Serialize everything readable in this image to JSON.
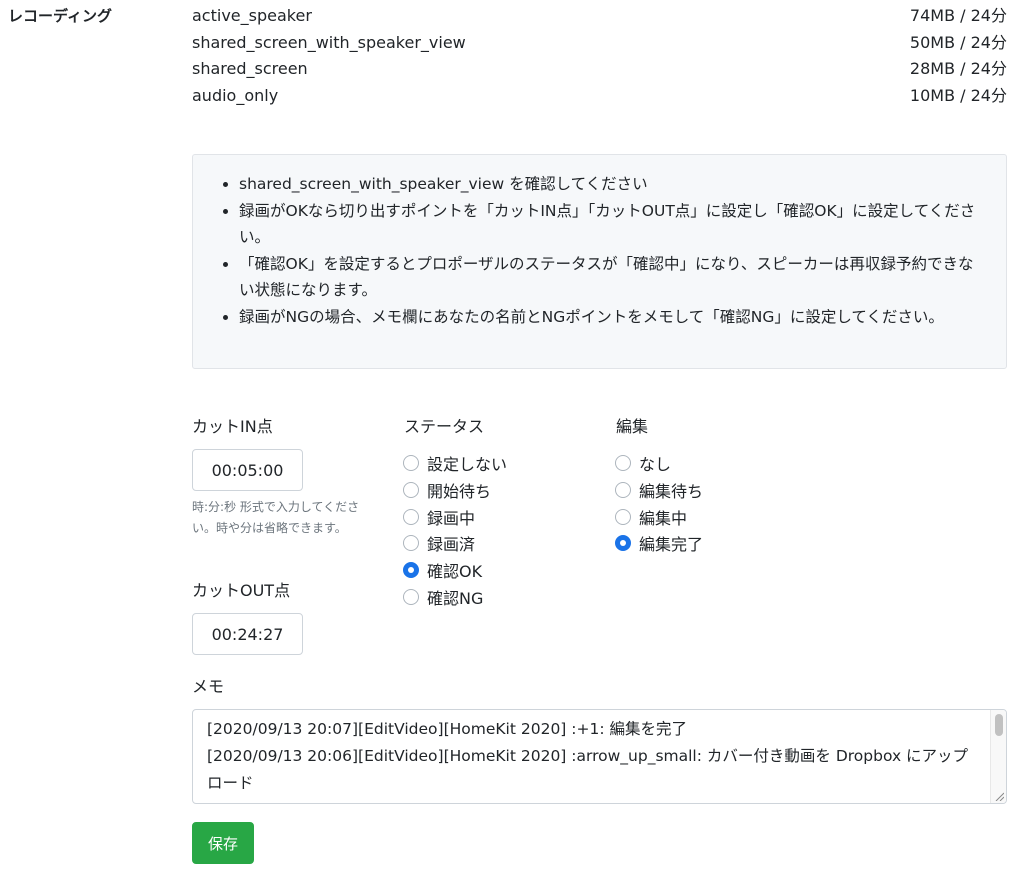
{
  "recordings": {
    "label": "レコーディング",
    "items": [
      {
        "name": "active_speaker",
        "size": "74MB / 24分"
      },
      {
        "name": "shared_screen_with_speaker_view",
        "size": "50MB / 24分"
      },
      {
        "name": "shared_screen",
        "size": "28MB / 24分"
      },
      {
        "name": "audio_only",
        "size": "10MB / 24分"
      }
    ]
  },
  "instructions": [
    "shared_screen_with_speaker_view を確認してください",
    "録画がOKなら切り出すポイントを「カットIN点」「カットOUT点」に設定し「確認OK」に設定してください。",
    "「確認OK」を設定するとプロポーザルのステータスが「確認中」になり、スピーカーは再収録予約できない状態になります。",
    "録画がNGの場合、メモ欄にあなたの名前とNGポイントをメモして「確認NG」に設定してください。"
  ],
  "cut_in": {
    "label": "カットIN点",
    "value": "00:05:00",
    "help": "時:分:秒 形式で入力してください。時や分は省略できます。"
  },
  "cut_out": {
    "label": "カットOUT点",
    "value": "00:24:27"
  },
  "status": {
    "label": "ステータス",
    "options": [
      "設定しない",
      "開始待ち",
      "録画中",
      "録画済",
      "確認OK",
      "確認NG"
    ],
    "selected": "確認OK"
  },
  "edit": {
    "label": "編集",
    "options": [
      "なし",
      "編集待ち",
      "編集中",
      "編集完了"
    ],
    "selected": "編集完了"
  },
  "memo": {
    "label": "メモ",
    "lines": [
      "[2020/09/13 20:07][EditVideo][HomeKit 2020] :+1: 編集を完了",
      "[2020/09/13 20:06][EditVideo][HomeKit 2020] :arrow_up_small: カバー付き動画を Dropbox にアップロード"
    ]
  },
  "save_label": "保存",
  "colors": {
    "accent": "#1a73e8",
    "save_button": "#28a745",
    "info_box_bg": "#f6f8fa",
    "help_text": "#6c757d"
  }
}
